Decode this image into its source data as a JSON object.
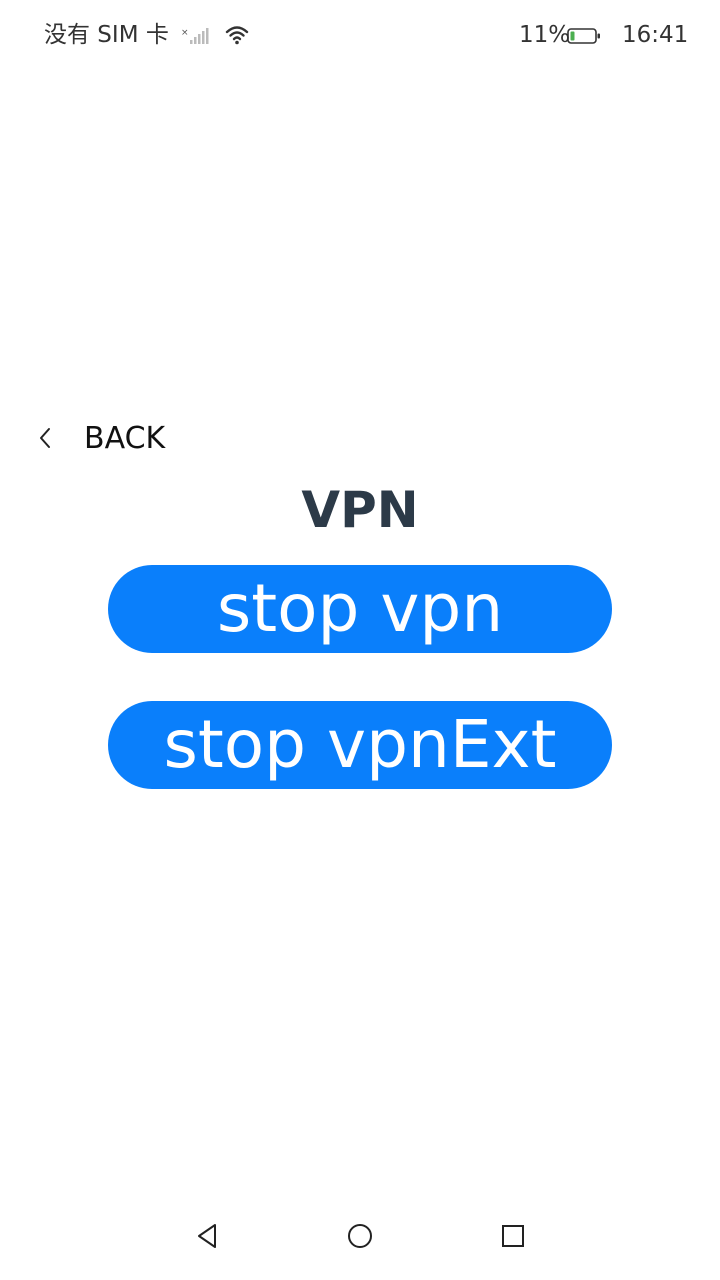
{
  "status_bar": {
    "carrier": "没有 SIM 卡",
    "battery_percent": "11%",
    "time": "16:41",
    "icons": [
      "signal-icon",
      "wifi-icon",
      "battery-icon"
    ]
  },
  "header": {
    "back_label": "BACK",
    "back_icon": "chevron-left-icon"
  },
  "main": {
    "title": "VPN",
    "buttons": [
      {
        "label": "stop vpn"
      },
      {
        "label": "stop vpnExt"
      }
    ]
  },
  "nav_bar": {
    "icons": [
      "triangle-back-icon",
      "circle-home-icon",
      "square-recent-icon"
    ]
  },
  "colors": {
    "accent": "#0a7ffb",
    "title": "#2c3a48",
    "battery_low": "#4caf50"
  }
}
